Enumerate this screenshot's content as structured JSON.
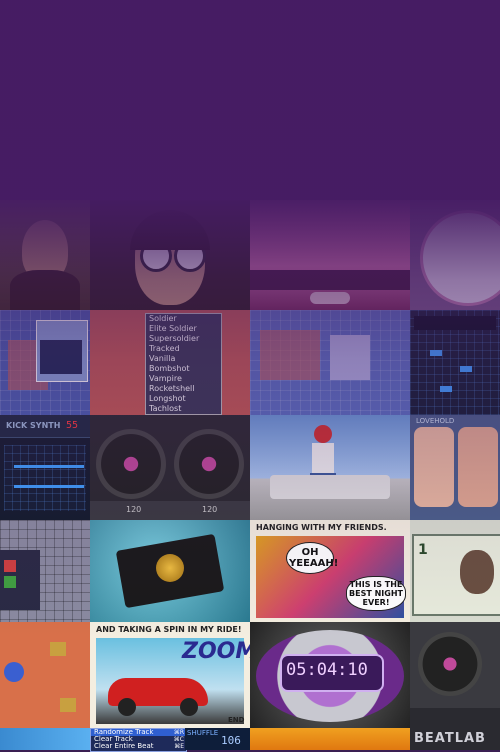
{
  "synth": {
    "title": "KICK SYNTH",
    "counter": "55"
  },
  "turntable": {
    "bpm_left": "120",
    "bpm_right": "120"
  },
  "photo_booth": {
    "title": "HANGING WITH MY FRIENDS.",
    "bubble_left": "OH YEEAAH!",
    "bubble_right": "THIS IS THE BEST NIGHT EVER!"
  },
  "zoom_comic": {
    "caption": "AND TAKING A SPIN IN MY RIDE!",
    "word": "ZOOM",
    "end": "END"
  },
  "clock": {
    "time": "05:04:10"
  },
  "menu": {
    "items": [
      "Randomize Track",
      "Clear Track",
      "Clear Entire Beat"
    ],
    "shortcuts": [
      "⌘R",
      "⌘C",
      "⌘E"
    ]
  },
  "shuffle": {
    "label": "SHUFFLE",
    "value": "106"
  },
  "beatlab": {
    "name": "BEATLAB"
  },
  "dollar": {
    "value": "1"
  },
  "face_app": {
    "title": "LOVEHOLD"
  },
  "strategy": {
    "units": [
      "Soldier",
      "Elite Soldier",
      "Supersoldier",
      "Tracked",
      "Vanilla",
      "Bombshot",
      "Vampire",
      "Rocketshell",
      "Longshot",
      "Tachlost"
    ]
  },
  "colors": {
    "overlay": "#461c64",
    "accent": "#c04a9a"
  }
}
